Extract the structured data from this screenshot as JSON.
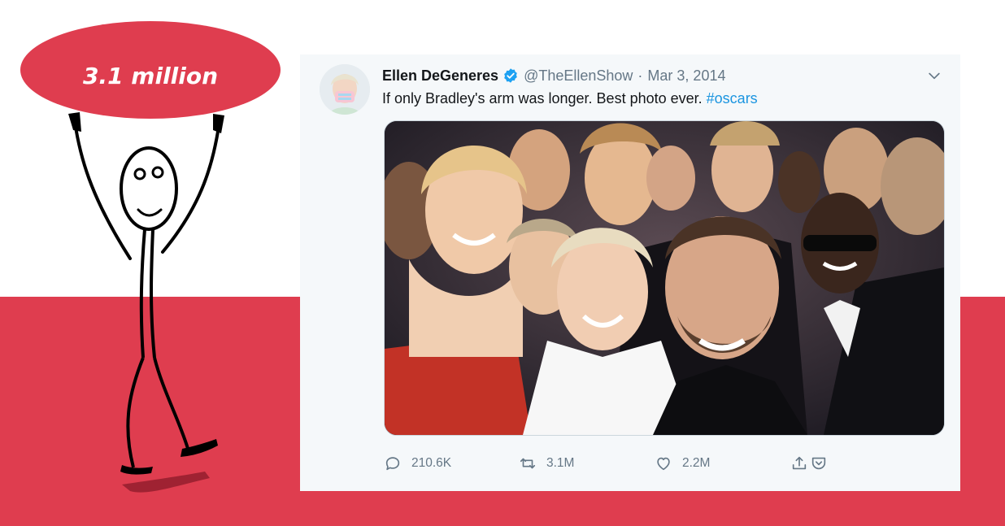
{
  "figure": {
    "bubble_text": "3.1 million",
    "colors": {
      "accent": "#df3d4f",
      "ink": "#000000"
    }
  },
  "tweet": {
    "author_name": "Ellen DeGeneres",
    "verified_icon": "verified-badge-icon",
    "handle": "@TheEllenShow",
    "separator": "·",
    "date": "Mar 3, 2014",
    "text": "If only Bradley's arm was longer. Best photo ever.",
    "hashtag": "#oscars",
    "media": "selfie-photo",
    "actions": {
      "replies": "210.6K",
      "retweets": "3.1M",
      "likes": "2.2M"
    },
    "colors": {
      "link": "#1b95e0",
      "muted": "#657786",
      "verified": "#1da1f2"
    }
  }
}
